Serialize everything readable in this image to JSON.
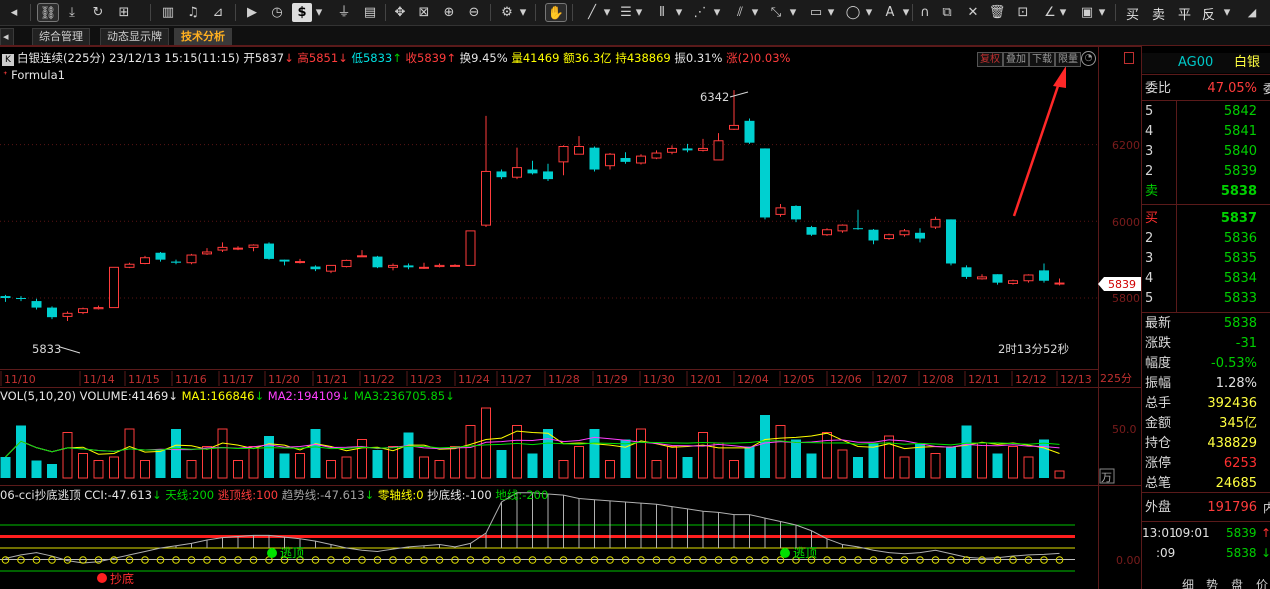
{
  "toolbar": {
    "right_buttons": [
      "买",
      "卖",
      "平",
      "反"
    ]
  },
  "tabs": [
    "综合管理",
    "动态显示牌",
    "技术分析"
  ],
  "info": {
    "k_label": "K",
    "name": "白银连续(225分)",
    "datetime": "23/12/13 15:15(11:15)",
    "open": "开5837",
    "open_arrow": "↓",
    "high": "高5851",
    "high_arrow": "↓",
    "low": "低5833",
    "low_arrow": "↑",
    "close": "收5839",
    "close_arrow": "↑",
    "turnover": "换9.45%",
    "volume": "量41469",
    "amount": "额36.3亿",
    "position": "持438869",
    "amplitude": "振0.31%",
    "change": "涨(2)0.03%",
    "formula": "Formula1",
    "buttons": [
      "复权",
      "叠加",
      "下载",
      "限量"
    ]
  },
  "main_chart": {
    "high_label": "6342",
    "low_label": "5833",
    "countdown": "2时13分52秒",
    "price_ticks": [
      "6200",
      "6000",
      "5800"
    ],
    "last_price": "5839",
    "period": "225分",
    "colors": {
      "up": "#ff3c3c",
      "down": "#00d0d0"
    }
  },
  "chart_data": {
    "type": "candlestick",
    "dates": [
      "11/10",
      "11/14",
      "11/15",
      "11/16",
      "11/17",
      "11/20",
      "11/21",
      "11/22",
      "11/23",
      "11/24",
      "11/27",
      "11/28",
      "11/29",
      "11/30",
      "12/01",
      "12/04",
      "12/05",
      "12/06",
      "12/07",
      "12/08",
      "12/11",
      "12/12",
      "12/13"
    ],
    "candles": [
      [
        5805,
        5800,
        5808,
        5790
      ],
      [
        5800,
        5798,
        5805,
        5792
      ],
      [
        5792,
        5775,
        5798,
        5770
      ],
      [
        5775,
        5750,
        5778,
        5745
      ],
      [
        5752,
        5760,
        5765,
        5740
      ],
      [
        5762,
        5772,
        5775,
        5758
      ],
      [
        5772,
        5775,
        5780,
        5770
      ],
      [
        5775,
        5880,
        5880,
        5775
      ],
      [
        5880,
        5888,
        5892,
        5878
      ],
      [
        5890,
        5905,
        5910,
        5888
      ],
      [
        5918,
        5900,
        5920,
        5895
      ],
      [
        5895,
        5892,
        5900,
        5888
      ],
      [
        5892,
        5912,
        5915,
        5888
      ],
      [
        5915,
        5920,
        5930,
        5912
      ],
      [
        5925,
        5932,
        5945,
        5920
      ],
      [
        5928,
        5930,
        5935,
        5925
      ],
      [
        5932,
        5938,
        5940,
        5922
      ],
      [
        5942,
        5902,
        5945,
        5900
      ],
      [
        5900,
        5895,
        5900,
        5885
      ],
      [
        5895,
        5895,
        5902,
        5890
      ],
      [
        5882,
        5875,
        5885,
        5870
      ],
      [
        5870,
        5885,
        5885,
        5865
      ],
      [
        5882,
        5898,
        5900,
        5880
      ],
      [
        5910,
        5910,
        5925,
        5908
      ],
      [
        5908,
        5880,
        5910,
        5878
      ],
      [
        5880,
        5885,
        5890,
        5872
      ],
      [
        5885,
        5880,
        5890,
        5875
      ],
      [
        5878,
        5880,
        5892,
        5876
      ],
      [
        5882,
        5885,
        5890,
        5880
      ],
      [
        5885,
        5885,
        5888,
        5882
      ],
      [
        5885,
        5975,
        5975,
        5885
      ],
      [
        5990,
        6130,
        6275,
        5985
      ],
      [
        6130,
        6115,
        6135,
        6110
      ],
      [
        6115,
        6140,
        6192,
        6110
      ],
      [
        6135,
        6125,
        6158,
        6122
      ],
      [
        6130,
        6110,
        6150,
        6105
      ],
      [
        6155,
        6195,
        6198,
        6120
      ],
      [
        6175,
        6195,
        6222,
        6175
      ],
      [
        6192,
        6135,
        6195,
        6130
      ],
      [
        6145,
        6175,
        6178,
        6135
      ],
      [
        6165,
        6155,
        6180,
        6150
      ],
      [
        6152,
        6170,
        6175,
        6148
      ],
      [
        6165,
        6178,
        6185,
        6162
      ],
      [
        6180,
        6190,
        6198,
        6175
      ],
      [
        6190,
        6185,
        6202,
        6180
      ],
      [
        6185,
        6190,
        6215,
        6182
      ],
      [
        6160,
        6210,
        6230,
        6160
      ],
      [
        6240,
        6250,
        6342,
        6238
      ],
      [
        6262,
        6205,
        6268,
        6202
      ],
      [
        6190,
        6010,
        6190,
        6005
      ],
      [
        6018,
        6035,
        6045,
        6012
      ],
      [
        6040,
        6005,
        6042,
        5998
      ],
      [
        5985,
        5965,
        5988,
        5962
      ],
      [
        5965,
        5978,
        5982,
        5962
      ],
      [
        5975,
        5990,
        5992,
        5970
      ],
      [
        5982,
        5980,
        6030,
        5978
      ],
      [
        5978,
        5950,
        5980,
        5940
      ],
      [
        5955,
        5965,
        5968,
        5952
      ],
      [
        5965,
        5975,
        5980,
        5960
      ],
      [
        5970,
        5955,
        5982,
        5945
      ],
      [
        5985,
        6005,
        6012,
        5980
      ],
      [
        6005,
        5890,
        6005,
        5885
      ],
      [
        5880,
        5855,
        5885,
        5850
      ],
      [
        5850,
        5855,
        5862,
        5848
      ],
      [
        5862,
        5840,
        5862,
        5835
      ],
      [
        5838,
        5845,
        5848,
        5835
      ],
      [
        5845,
        5860,
        5862,
        5840
      ],
      [
        5872,
        5845,
        5890,
        5840
      ],
      [
        5837,
        5839,
        5851,
        5833
      ]
    ]
  },
  "volume": {
    "header": "VOL(5,10,20)",
    "volume_label": "VOLUME:41469",
    "ma1": "MA1:166846",
    "ma2": "MA2:194109",
    "ma3": "MA3:236705.85",
    "down1": "↓",
    "down2": "↓",
    "down3": "↓",
    "tick": "50.0",
    "unit": "万",
    "values": [
      6,
      15,
      5,
      4,
      13,
      7,
      5,
      6,
      14,
      5,
      8,
      14,
      5,
      9,
      14,
      5,
      9,
      12,
      7,
      7,
      14,
      5,
      6,
      11,
      8,
      9,
      13,
      6,
      5,
      9,
      15,
      20,
      8,
      15,
      7,
      14,
      5,
      9,
      14,
      5,
      11,
      14,
      5,
      9,
      6,
      13,
      10,
      5,
      9,
      18,
      15,
      11,
      7,
      13,
      8,
      6,
      10,
      12,
      6,
      10,
      7,
      9,
      15,
      10,
      7,
      9,
      6,
      11,
      2
    ]
  },
  "cci": {
    "header": "06-cci抄底逃顶",
    "cci_value": "CCI:-47.613",
    "cci_arrow": "↓",
    "sky": "天线:200",
    "top_escape": "逃顶线:100",
    "trend": "趋势线:-47.613",
    "trend_arrow": "↓",
    "zero": "零轴线:0",
    "bottom_buy": "抄底线:-100",
    "ground": "地线:-200",
    "tick": "0.00",
    "marker_escape": "逃顶",
    "marker_bottom": "抄底"
  },
  "quote_panel": {
    "code": "AG00",
    "name": "白银",
    "weibi_label": "委比",
    "weibi_value": "47.05%",
    "sell_levels": [
      [
        "5",
        "5842"
      ],
      [
        "4",
        "5841"
      ],
      [
        "3",
        "5840"
      ],
      [
        "2",
        "5839"
      ],
      [
        "卖",
        "5838"
      ]
    ],
    "buy_levels": [
      [
        "买",
        "5837"
      ],
      [
        "2",
        "5836"
      ],
      [
        "3",
        "5835"
      ],
      [
        "4",
        "5834"
      ],
      [
        "5",
        "5833"
      ]
    ],
    "stats": [
      [
        "最新",
        "5838"
      ],
      [
        "涨跌",
        "-31"
      ],
      [
        "幅度",
        "-0.53%"
      ],
      [
        "振幅",
        "1.28%"
      ],
      [
        "总手",
        "392436"
      ],
      [
        "金额",
        "345亿"
      ],
      [
        "持仓",
        "438829"
      ],
      [
        "涨停",
        "6253"
      ],
      [
        "总笔",
        "24685"
      ]
    ],
    "outer_label": "外盘",
    "outer_value": "191796",
    "ticks": [
      [
        "13:01",
        "09:01",
        "5839",
        "↑"
      ],
      [
        ":09",
        "",
        "5838",
        "↓"
      ]
    ],
    "bottom_buttons": [
      "细",
      "势",
      "盘",
      "价"
    ]
  }
}
